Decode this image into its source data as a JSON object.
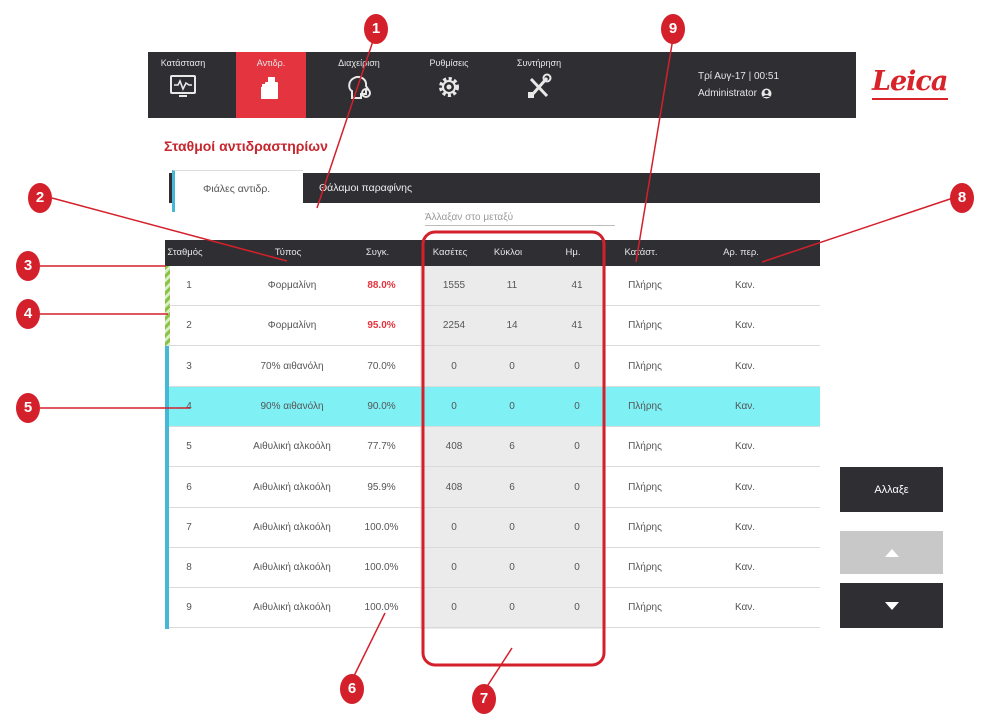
{
  "nav": {
    "tabs": [
      {
        "label": "Κατάσταση",
        "icon": "status-monitor-icon"
      },
      {
        "label": "Αντιδρ.",
        "icon": "reagent-bottle-icon"
      },
      {
        "label": "Διαχείριση",
        "icon": "admin-head-gear-icon"
      },
      {
        "label": "Ρυθμίσεις",
        "icon": "settings-gear-icon"
      },
      {
        "label": "Συντήρηση",
        "icon": "maintenance-tools-icon"
      }
    ],
    "active_tab": "Αντιδρ.",
    "datetime": "Τρί Αυγ-17 | 00:51",
    "user": "Administrator",
    "logo": "Leica",
    "active_color": "#e3343f",
    "bar_color": "#2e2e33"
  },
  "page": {
    "title": "Σταθμοί αντιδραστηρίων",
    "subtabs": [
      "Φιάλες αντιδρ.",
      "Θάλαμοι παραφίνης"
    ],
    "changed_note": "Άλλαξαν στο μεταξύ"
  },
  "table": {
    "columns": [
      "Σταθμός",
      "Τύπος",
      "Συγκ.",
      "Κασέτες",
      "Κύκλοι",
      "Ημ.",
      "Κατάστ.",
      "Αρ. περ."
    ],
    "rows": [
      {
        "station": "1",
        "type": "Φορμαλίνη",
        "conc": "88.0%",
        "conc_alert": true,
        "cassettes": "1555",
        "cycles": "11",
        "days": "41",
        "status": "Πλήρης",
        "exposure": "Καν."
      },
      {
        "station": "2",
        "type": "Φορμαλίνη",
        "conc": "95.0%",
        "conc_alert": true,
        "cassettes": "2254",
        "cycles": "14",
        "days": "41",
        "status": "Πλήρης",
        "exposure": "Καν."
      },
      {
        "station": "3",
        "type": "70% αιθανόλη",
        "conc": "70.0%",
        "conc_alert": false,
        "cassettes": "0",
        "cycles": "0",
        "days": "0",
        "status": "Πλήρης",
        "exposure": "Καν."
      },
      {
        "station": "4",
        "type": "90% αιθανόλη",
        "conc": "90.0%",
        "conc_alert": false,
        "cassettes": "0",
        "cycles": "0",
        "days": "0",
        "status": "Πλήρης",
        "exposure": "Καν.",
        "selected": true
      },
      {
        "station": "5",
        "type": "Αιθυλική αλκοόλη",
        "conc": "77.7%",
        "conc_alert": false,
        "cassettes": "408",
        "cycles": "6",
        "days": "0",
        "status": "Πλήρης",
        "exposure": "Καν."
      },
      {
        "station": "6",
        "type": "Αιθυλική αλκοόλη",
        "conc": "95.9%",
        "conc_alert": false,
        "cassettes": "408",
        "cycles": "6",
        "days": "0",
        "status": "Πλήρης",
        "exposure": "Καν."
      },
      {
        "station": "7",
        "type": "Αιθυλική αλκοόλη",
        "conc": "100.0%",
        "conc_alert": false,
        "cassettes": "0",
        "cycles": "0",
        "days": "0",
        "status": "Πλήρης",
        "exposure": "Καν."
      },
      {
        "station": "8",
        "type": "Αιθυλική αλκοόλη",
        "conc": "100.0%",
        "conc_alert": false,
        "cassettes": "0",
        "cycles": "0",
        "days": "0",
        "status": "Πλήρης",
        "exposure": "Καν."
      },
      {
        "station": "9",
        "type": "Αιθυλική αλκοόλη",
        "conc": "100.0%",
        "conc_alert": false,
        "cassettes": "0",
        "cycles": "0",
        "days": "0",
        "status": "Πλήρης",
        "exposure": "Καν."
      }
    ]
  },
  "controls": {
    "change_label": "Αλλαξε",
    "up_icon": "triangle-up-icon",
    "down_icon": "triangle-down-icon"
  },
  "callouts": [
    "1",
    "2",
    "3",
    "4",
    "5",
    "6",
    "7",
    "8",
    "9"
  ],
  "colors": {
    "callout": "#d4202a",
    "selected_row": "#7ff0f4",
    "alert_text": "#e3343f",
    "strip": "#46b8d6",
    "green_strip": "#8bc34a"
  }
}
